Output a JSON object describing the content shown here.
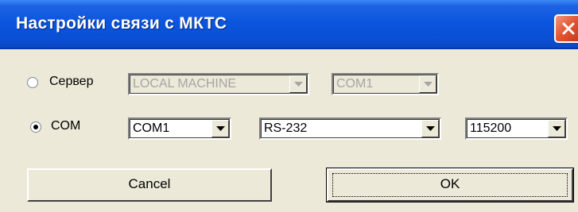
{
  "window": {
    "title": "Настройки связи с МКТС"
  },
  "server_row": {
    "radio_label": "Сервер",
    "selected": false,
    "machine_combo": {
      "value": "LOCAL MACHINE",
      "enabled": false
    },
    "port_combo": {
      "value": "COM1",
      "enabled": false
    }
  },
  "com_row": {
    "radio_label": "COM",
    "selected": true,
    "port_combo": {
      "value": "COM1",
      "enabled": true
    },
    "interface_combo": {
      "value": "RS-232",
      "enabled": true
    },
    "baud_combo": {
      "value": "115200",
      "enabled": true
    }
  },
  "buttons": {
    "cancel_label": "Cancel",
    "ok_label": "OK"
  },
  "icons": {
    "close": "close-icon",
    "dropdown": "chevron-down-icon"
  },
  "colors": {
    "titlebar": "#0a4fd3",
    "close_button": "#e2532d",
    "dialog_background": "#ece9d8"
  }
}
